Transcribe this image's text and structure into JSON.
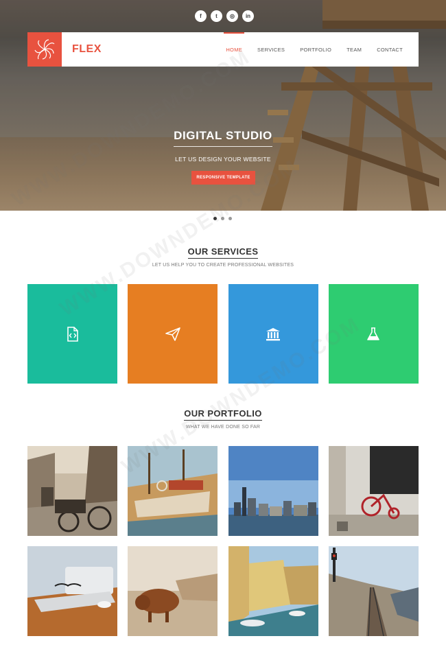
{
  "social": [
    "f",
    "t",
    "◎",
    "in"
  ],
  "brand": {
    "name": "FLEX"
  },
  "nav": [
    "HOME",
    "SERVICES",
    "PORTFOLIO",
    "TEAM",
    "CONTACT"
  ],
  "hero": {
    "title": "DIGITAL STUDIO",
    "subtitle": "LET US DESIGN YOUR WEBSITE",
    "button": "RESPONSIVE TEMPLATE"
  },
  "services": {
    "title": "OUR SERVICES",
    "subtitle": "LET US HELP YOU TO CREATE PROFESSIONAL WEBSITES",
    "tiles": [
      {
        "icon": "code-file-icon",
        "color": "#1abc9c"
      },
      {
        "icon": "paper-plane-icon",
        "color": "#e67e22"
      },
      {
        "icon": "bank-icon",
        "color": "#3498db"
      },
      {
        "icon": "flask-icon",
        "color": "#2ecc71"
      }
    ]
  },
  "portfolio": {
    "title": "OUR PORTFOLIO",
    "subtitle": "WHAT WE HAVE DONE SO FAR"
  },
  "watermark": "WWW.DOWNDEMO.COM",
  "colors": {
    "accent": "#e8523f"
  }
}
